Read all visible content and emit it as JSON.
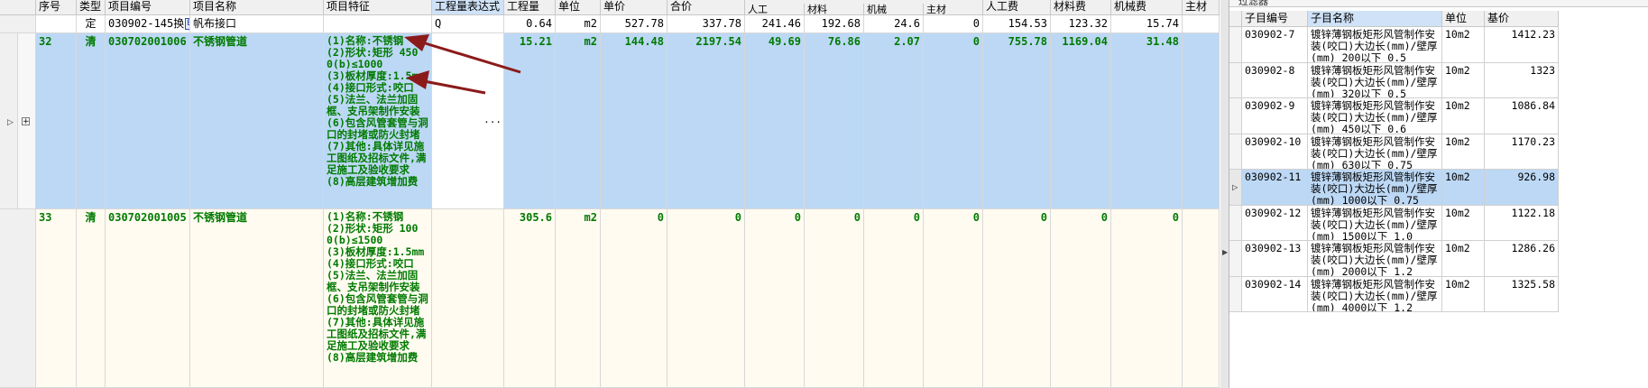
{
  "left_table": {
    "headers": {
      "seq": "序号",
      "type": "类型",
      "code": "项目编号",
      "name": "项目名称",
      "feature": "项目特征",
      "expr": "工程量表达式",
      "qty": "工程量",
      "unit": "单位",
      "price": "单价",
      "total": "合价",
      "labor": "人工",
      "material": "材料",
      "machine": "机械",
      "main_mat": "主材",
      "labor_fee": "人工费",
      "material_fee": "材料费",
      "machine_fee": "机械费",
      "main_mat_fee": "主材"
    },
    "quota_row": {
      "type": "定",
      "code": "030902-145换",
      "badge": "Bz",
      "name": "帆布接口",
      "expr": "Q",
      "qty": "0.64",
      "unit": "m2",
      "price": "527.78",
      "total": "337.78",
      "labor": "241.46",
      "material": "192.68",
      "machine": "24.6",
      "main_mat": "0",
      "labor_fee": "154.53",
      "material_fee": "123.32",
      "machine_fee": "15.74"
    },
    "row32": {
      "seq": "32",
      "type": "清",
      "code": "030702001006",
      "name": "不锈钢管道",
      "feature": "(1)名称:不锈钢\n(2)形状:矩形 450\n0(b)≤1000\n(3)板材厚度:1.5mm\n(4)接口形式:咬口\n(5)法兰、法兰加固框、支吊架制作安装\n(6)包含风管套管与洞口的封堵或防火封堵\n(7)其他:具体详见施工图纸及招标文件,满足施工及验收要求\n(8)高层建筑增加费",
      "expr_btn": "...",
      "qty": "15.21",
      "unit": "m2",
      "price": "144.48",
      "total": "2197.54",
      "labor": "49.69",
      "material": "76.86",
      "machine": "2.07",
      "main_mat": "0",
      "labor_fee": "755.78",
      "material_fee": "1169.04",
      "machine_fee": "31.48"
    },
    "row33": {
      "seq": "33",
      "type": "清",
      "code": "030702001005",
      "name": "不锈钢管道",
      "feature": "(1)名称:不锈钢\n(2)形状:矩形 100\n0(b)≤1500\n(3)板材厚度:1.5mm\n(4)接口形式:咬口\n(5)法兰、法兰加固框、支吊架制作安装\n(6)包含风管套管与洞口的封堵或防火封堵\n(7)其他:具体详见施工图纸及招标文件,满足施工及验收要求\n(8)高层建筑增加费",
      "qty": "305.6",
      "unit": "m2",
      "price": "0",
      "total": "0",
      "labor": "0",
      "material": "0",
      "machine": "0",
      "main_mat": "0",
      "labor_fee": "0",
      "material_fee": "0",
      "machine_fee": "0"
    }
  },
  "right_table": {
    "title": "过滤器",
    "headers": {
      "code": "子目编号",
      "name": "子目名称",
      "unit": "单位",
      "price": "基价"
    },
    "rows": [
      {
        "code": "030902-7",
        "name": "镀锌薄钢板矩形风管制作安装(咬口)大边长(mm)/壁厚(mm) 200以下 0.5",
        "unit": "10m2",
        "price": "1412.23"
      },
      {
        "code": "030902-8",
        "name": "镀锌薄钢板矩形风管制作安装(咬口)大边长(mm)/壁厚(mm) 320以下 0.5",
        "unit": "10m2",
        "price": "1323"
      },
      {
        "code": "030902-9",
        "name": "镀锌薄钢板矩形风管制作安装(咬口)大边长(mm)/壁厚(mm) 450以下 0.6",
        "unit": "10m2",
        "price": "1086.84"
      },
      {
        "code": "030902-10",
        "name": "镀锌薄钢板矩形风管制作安装(咬口)大边长(mm)/壁厚(mm) 630以下 0.75",
        "unit": "10m2",
        "price": "1170.23"
      },
      {
        "code": "030902-11",
        "name": "镀锌薄钢板矩形风管制作安装(咬口)大边长(mm)/壁厚(mm) 1000以下 0.75",
        "unit": "10m2",
        "price": "926.98"
      },
      {
        "code": "030902-12",
        "name": "镀锌薄钢板矩形风管制作安装(咬口)大边长(mm)/壁厚(mm) 1500以下 1.0",
        "unit": "10m2",
        "price": "1122.18"
      },
      {
        "code": "030902-13",
        "name": "镀锌薄钢板矩形风管制作安装(咬口)大边长(mm)/壁厚(mm) 2000以下 1.2",
        "unit": "10m2",
        "price": "1286.26"
      },
      {
        "code": "030902-14",
        "name": "镀锌薄钢板矩形风管制作安装(咬口)大边长(mm)/壁厚(mm) 4000以下 1.2",
        "unit": "10m2",
        "price": "1325.58"
      }
    ]
  },
  "colors": {
    "selection": "#bcd8f5",
    "green_text": "#007a00",
    "arrow": "#8b1a1a"
  }
}
